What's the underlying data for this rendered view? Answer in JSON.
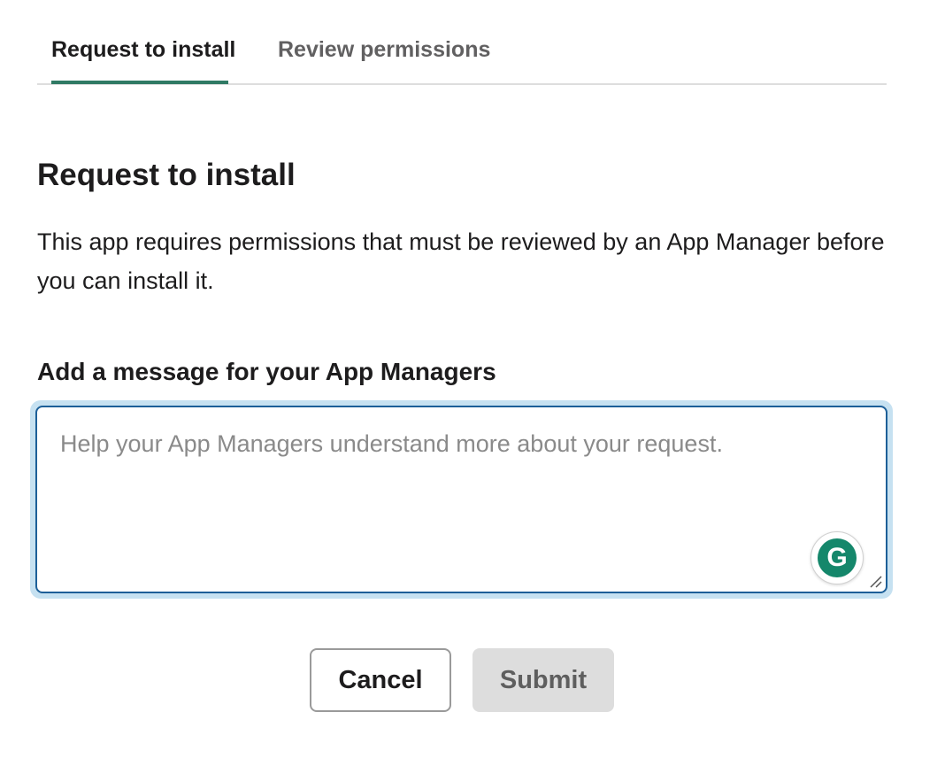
{
  "tabs": [
    {
      "label": "Request to install",
      "active": true
    },
    {
      "label": "Review permissions",
      "active": false
    }
  ],
  "main": {
    "heading": "Request to install",
    "description": "This app requires permissions that must be reviewed by an App Manager before you can install it.",
    "field_label": "Add a message for your App Managers",
    "message": {
      "value": "",
      "placeholder": "Help your App Managers understand more about your request."
    },
    "grammarly_icon": "grammarly-icon",
    "grammarly_letter": "G"
  },
  "actions": {
    "cancel_label": "Cancel",
    "submit_label": "Submit",
    "submit_disabled": true
  },
  "colors": {
    "accent_tab": "#2f7a64",
    "focus_border": "#1d5f98",
    "focus_ring": "#c6e1f1",
    "grammarly": "#15876b"
  }
}
